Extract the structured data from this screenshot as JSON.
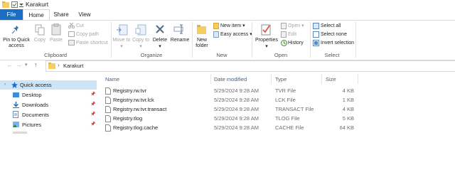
{
  "window": {
    "title": "Karakurt"
  },
  "tabs": [
    {
      "label": "File"
    },
    {
      "label": "Home"
    },
    {
      "label": "Share"
    },
    {
      "label": "View"
    }
  ],
  "ribbon": {
    "clipboard": {
      "pin_quick_access": "Pin to Quick access",
      "copy": "Copy",
      "paste": "Paste",
      "cut": "Cut",
      "copy_path": "Copy path",
      "paste_shortcut": "Paste shortcut",
      "label": "Clipboard"
    },
    "organize": {
      "move_to": "Move to",
      "copy_to": "Copy to",
      "delete": "Delete",
      "rename": "Rename",
      "label": "Organize"
    },
    "new": {
      "new_folder": "New folder",
      "new_item": "New item",
      "easy_access": "Easy access",
      "label": "New"
    },
    "open": {
      "properties": "Properties",
      "open": "Open",
      "edit": "Edit",
      "history": "History",
      "label": "Open"
    },
    "select": {
      "select_all": "Select all",
      "select_none": "Select none",
      "invert_selection": "Invert selection",
      "label": "Select"
    }
  },
  "address": {
    "crumb": "Karakurt"
  },
  "nav": [
    {
      "label": "Quick access"
    },
    {
      "label": "Desktop"
    },
    {
      "label": "Downloads"
    },
    {
      "label": "Documents"
    },
    {
      "label": "Pictures"
    }
  ],
  "columns": {
    "name": "Name",
    "date": "Date modified",
    "type": "Type",
    "size": "Size"
  },
  "files": [
    {
      "name": "Registry.rw.tvr",
      "date": "5/29/2024 9:28 AM",
      "type": "TVR File",
      "size": "4 KB"
    },
    {
      "name": "Registry.rw.tvr.lck",
      "date": "5/29/2024 9:28 AM",
      "type": "LCK File",
      "size": "1 KB"
    },
    {
      "name": "Registry.rw.tvr.transact",
      "date": "5/29/2024 9:28 AM",
      "type": "TRANSACT File",
      "size": "4 KB"
    },
    {
      "name": "Registry.tlog",
      "date": "5/29/2024 9:28 AM",
      "type": "TLOG File",
      "size": "5 KB"
    },
    {
      "name": "Registry.tlog.cache",
      "date": "5/29/2024 9:28 AM",
      "type": "CACHE File",
      "size": "64 KB"
    }
  ],
  "colors": {
    "file_tab": "#1a6fc4",
    "selected_nav": "#cce4f7",
    "folder": "#f4cd63",
    "header_text": "#4c607a"
  }
}
